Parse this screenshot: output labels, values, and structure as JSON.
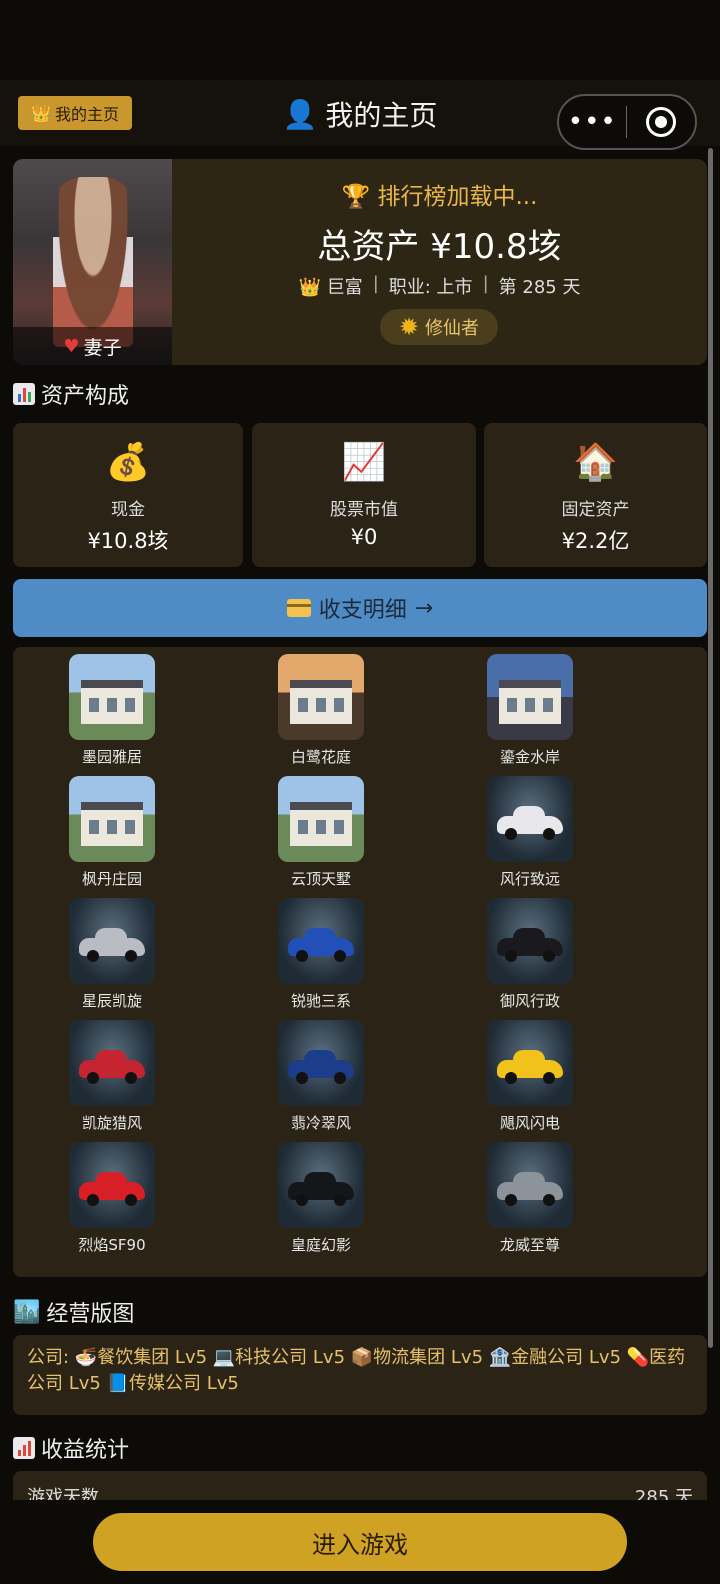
{
  "header": {
    "badge_label": "我的主页",
    "title": "我的主页",
    "more_label": "•••"
  },
  "profile": {
    "avatar_label": "妻子",
    "rank_text": "排行榜加载中...",
    "total_assets": "总资产  ¥10.8垓",
    "tier": "巨富",
    "job": "职业: 上市",
    "day": "第 285 天",
    "title_chip": "修仙者"
  },
  "assets_section": {
    "title": "资产构成"
  },
  "assets": [
    {
      "icon": "money-bag-icon",
      "glyph": "💰",
      "label": "现金",
      "value": "¥10.8垓"
    },
    {
      "icon": "chart-up-icon",
      "glyph": "📈",
      "label": "股票市值",
      "value": "¥0"
    },
    {
      "icon": "house-icon",
      "glyph": "🏠",
      "label": "固定资产",
      "value": "¥2.2亿"
    }
  ],
  "ledger_button": {
    "label": "收支明细",
    "arrow": "→"
  },
  "gallery": [
    {
      "label": "墨园雅居",
      "kind": "house"
    },
    {
      "label": "白鹭花庭",
      "kind": "house"
    },
    {
      "label": "鎏金水岸",
      "kind": "house"
    },
    {
      "label": "枫丹庄园",
      "kind": "house"
    },
    {
      "label": "云顶天墅",
      "kind": "house"
    },
    {
      "label": "风行致远",
      "kind": "car",
      "color": "#e8e8ec"
    },
    {
      "label": "星辰凯旋",
      "kind": "car",
      "color": "#b9bcc2"
    },
    {
      "label": "锐驰三系",
      "kind": "car",
      "color": "#2250b8"
    },
    {
      "label": "御风行政",
      "kind": "car",
      "color": "#1a1a1e"
    },
    {
      "label": "凯旋猎风",
      "kind": "car",
      "color": "#c42530"
    },
    {
      "label": "翡冷翠风",
      "kind": "car",
      "color": "#1c3e8a"
    },
    {
      "label": "飓风闪电",
      "kind": "car",
      "color": "#f1c21b"
    },
    {
      "label": "烈焰SF90",
      "kind": "car",
      "color": "#d81f26"
    },
    {
      "label": "皇庭幻影",
      "kind": "car",
      "color": "#15161a"
    },
    {
      "label": "龙威至尊",
      "kind": "car",
      "color": "#8d939b"
    }
  ],
  "business_section": {
    "title": "经营版图"
  },
  "business": {
    "text": "公司: 🍜餐饮集团 Lv5 💻科技公司 Lv5 📦物流集团 Lv5 🏦金融公司 Lv5 💊医药公司 Lv5 📘传媒公司 Lv5"
  },
  "stats_section": {
    "title": "收益统计"
  },
  "stats": {
    "days_label": "游戏天数",
    "days_value": "285 天"
  },
  "enter_button": {
    "label": "进入游戏"
  },
  "colors": {
    "accent_gold": "#cfa224",
    "ledger_blue": "#4f8bc4",
    "card_bg": "#2b2416"
  }
}
